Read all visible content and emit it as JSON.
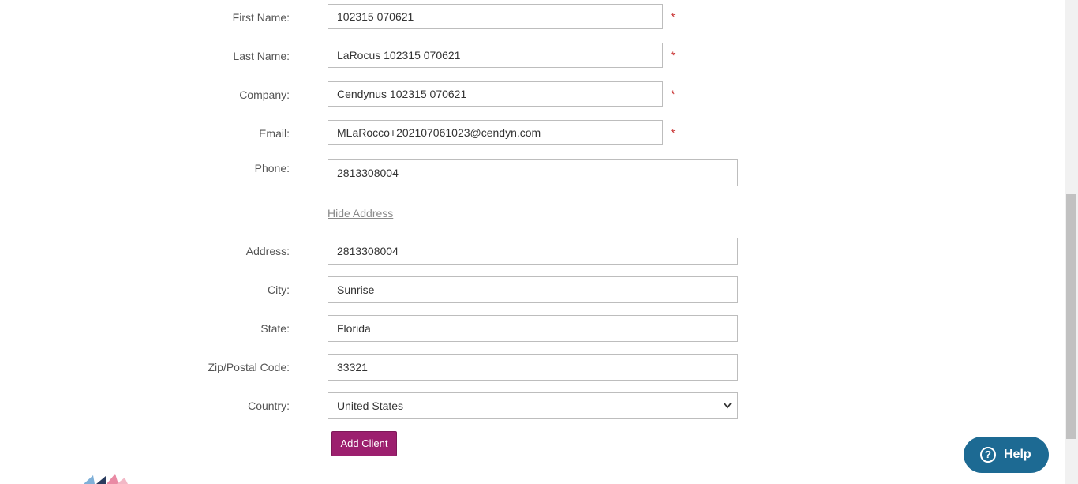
{
  "form": {
    "first_name": {
      "label": "First Name:",
      "value": "102315 070621",
      "required": "*"
    },
    "last_name": {
      "label": "Last Name:",
      "value": "LaRocus 102315 070621",
      "required": "*"
    },
    "company": {
      "label": "Company:",
      "value": "Cendynus 102315 070621",
      "required": "*"
    },
    "email": {
      "label": "Email:",
      "value": "MLaRocco+202107061023@cendyn.com",
      "required": "*"
    },
    "phone": {
      "label": "Phone:",
      "value": "2813308004"
    },
    "hide_address_link": "Hide Address",
    "address": {
      "label": "Address:",
      "value": "2813308004"
    },
    "city": {
      "label": "City:",
      "value": "Sunrise"
    },
    "state": {
      "label": "State:",
      "value": "Florida"
    },
    "zip": {
      "label": "Zip/Postal Code:",
      "value": "33321"
    },
    "country": {
      "label": "Country:",
      "value": "United States"
    },
    "submit_label": "Add Client"
  },
  "help_widget": {
    "icon_glyph": "?",
    "label": "Help"
  },
  "colors": {
    "button_bg": "#9c1f6e",
    "help_bg": "#1d6a93",
    "required": "#c62828"
  }
}
